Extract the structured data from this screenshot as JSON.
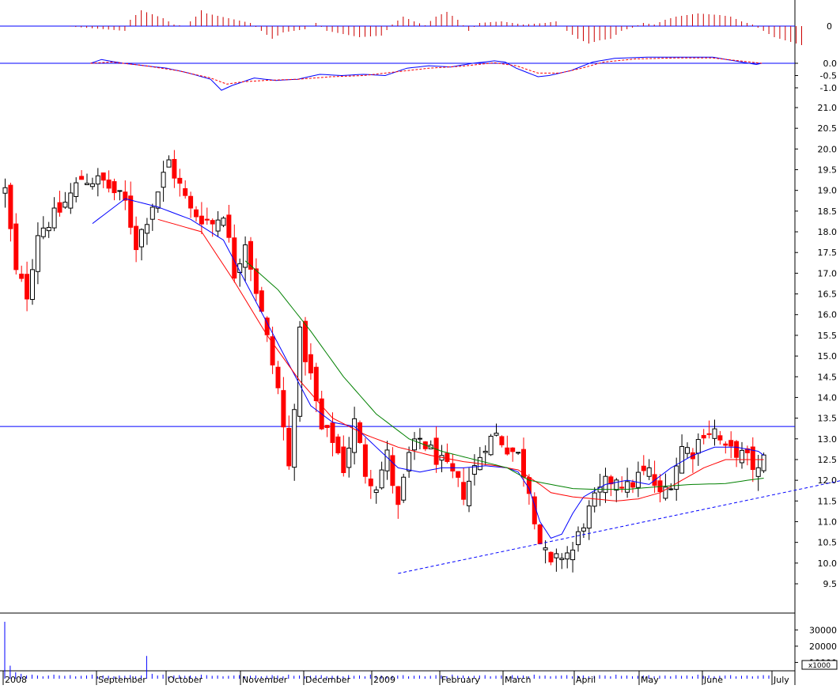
{
  "chart_data": {
    "type": "candlestick",
    "colors": {
      "up_candle": "#000000",
      "down_candle": "#ff0000",
      "ma_short": "#0000ff",
      "ma_medium": "#ff0000",
      "ma_long": "#008000",
      "hist": "#cc0000",
      "macd": "#0000ff",
      "macd_signal": "#ff0000",
      "resistance": "#0000ff",
      "trendline": "#0000ff",
      "volume": "#0000ff",
      "grid": "#000000"
    },
    "x_axis": {
      "labels": [
        "2008",
        "September",
        "October",
        "November",
        "December",
        "2009",
        "February",
        "March",
        "April",
        "May",
        "June",
        "July"
      ]
    },
    "price": {
      "ylim": [
        9.3,
        21.2
      ],
      "ticks": [
        "9.5",
        "10.0",
        "10.5",
        "11.0",
        "11.5",
        "12.0",
        "12.5",
        "13.0",
        "13.5",
        "14.0",
        "14.5",
        "15.0",
        "15.5",
        "16.0",
        "16.5",
        "17.0",
        "17.5",
        "18.0",
        "18.5",
        "19.0",
        "19.5",
        "20.0",
        "20.5",
        "21.0"
      ],
      "resistance": 13.3,
      "trendline": {
        "from": [
          72,
          9.75
        ],
        "to": [
          186,
          12.9
        ]
      },
      "close_anchors": [
        [
          0,
          19.0
        ],
        [
          2,
          17.0
        ],
        [
          4,
          16.5
        ],
        [
          6,
          18.0
        ],
        [
          10,
          18.5
        ],
        [
          14,
          19.3
        ],
        [
          18,
          19.2
        ],
        [
          22,
          18.7
        ],
        [
          24,
          17.7
        ],
        [
          28,
          19.0
        ],
        [
          30,
          19.7
        ],
        [
          34,
          18.5
        ],
        [
          38,
          18.2
        ],
        [
          40,
          18.5
        ],
        [
          42,
          17.0
        ],
        [
          44,
          17.8
        ],
        [
          47,
          16.0
        ],
        [
          50,
          14.2
        ],
        [
          52,
          12.3
        ],
        [
          54,
          15.5
        ],
        [
          56,
          14.5
        ],
        [
          58,
          13.2
        ],
        [
          60,
          13.0
        ],
        [
          62,
          12.3
        ],
        [
          64,
          13.4
        ],
        [
          66,
          12.2
        ],
        [
          68,
          11.9
        ],
        [
          70,
          12.6
        ],
        [
          72,
          11.3
        ],
        [
          74,
          12.6
        ],
        [
          76,
          13.0
        ],
        [
          78,
          12.7
        ],
        [
          80,
          12.4
        ],
        [
          82,
          12.1
        ],
        [
          84,
          11.7
        ],
        [
          86,
          12.3
        ],
        [
          88,
          12.9
        ],
        [
          90,
          13.1
        ],
        [
          92,
          12.8
        ],
        [
          94,
          12.6
        ],
        [
          96,
          11.8
        ],
        [
          98,
          10.5
        ],
        [
          100,
          9.9
        ],
        [
          102,
          10.2
        ],
        [
          104,
          10.3
        ],
        [
          106,
          11.0
        ],
        [
          108,
          11.5
        ],
        [
          110,
          11.9
        ],
        [
          112,
          12.1
        ],
        [
          114,
          11.8
        ],
        [
          116,
          12.1
        ],
        [
          118,
          12.2
        ],
        [
          120,
          11.6
        ],
        [
          122,
          12.0
        ],
        [
          124,
          12.8
        ],
        [
          126,
          12.7
        ],
        [
          128,
          13.2
        ],
        [
          130,
          13.2
        ],
        [
          132,
          12.7
        ],
        [
          134,
          12.7
        ],
        [
          136,
          12.5
        ],
        [
          138,
          12.2
        ],
        [
          139,
          12.5
        ]
      ],
      "ma_short_anchors": [
        [
          16,
          18.2
        ],
        [
          22,
          18.8
        ],
        [
          28,
          18.6
        ],
        [
          34,
          18.3
        ],
        [
          40,
          17.8
        ],
        [
          44,
          16.8
        ],
        [
          48,
          15.8
        ],
        [
          52,
          14.8
        ],
        [
          56,
          13.8
        ],
        [
          60,
          13.4
        ],
        [
          64,
          13.3
        ],
        [
          68,
          12.8
        ],
        [
          72,
          12.3
        ],
        [
          76,
          12.2
        ],
        [
          80,
          12.3
        ],
        [
          84,
          12.3
        ],
        [
          88,
          12.35
        ],
        [
          92,
          12.3
        ],
        [
          94,
          12.2
        ],
        [
          96,
          11.8
        ],
        [
          98,
          11.0
        ],
        [
          100,
          10.6
        ],
        [
          102,
          10.7
        ],
        [
          104,
          11.2
        ],
        [
          106,
          11.6
        ],
        [
          110,
          11.9
        ],
        [
          114,
          12.0
        ],
        [
          118,
          11.9
        ],
        [
          122,
          12.3
        ],
        [
          126,
          12.6
        ],
        [
          130,
          12.8
        ],
        [
          134,
          12.8
        ],
        [
          138,
          12.7
        ],
        [
          139,
          12.6
        ]
      ],
      "ma_medium_anchors": [
        [
          28,
          18.3
        ],
        [
          36,
          18.0
        ],
        [
          42,
          16.8
        ],
        [
          48,
          15.5
        ],
        [
          54,
          14.4
        ],
        [
          60,
          13.5
        ],
        [
          66,
          13.1
        ],
        [
          72,
          12.8
        ],
        [
          78,
          12.6
        ],
        [
          84,
          12.45
        ],
        [
          90,
          12.35
        ],
        [
          94,
          12.25
        ],
        [
          98,
          11.9
        ],
        [
          100,
          11.7
        ],
        [
          104,
          11.6
        ],
        [
          108,
          11.55
        ],
        [
          112,
          11.5
        ],
        [
          116,
          11.55
        ],
        [
          120,
          11.7
        ],
        [
          124,
          12.0
        ],
        [
          128,
          12.3
        ],
        [
          132,
          12.5
        ],
        [
          136,
          12.5
        ],
        [
          139,
          12.5
        ]
      ],
      "ma_long_anchors": [
        [
          44,
          17.3
        ],
        [
          50,
          16.6
        ],
        [
          56,
          15.6
        ],
        [
          62,
          14.5
        ],
        [
          68,
          13.6
        ],
        [
          74,
          13.0
        ],
        [
          80,
          12.7
        ],
        [
          86,
          12.5
        ],
        [
          92,
          12.3
        ],
        [
          96,
          12.0
        ],
        [
          100,
          11.9
        ],
        [
          104,
          11.8
        ],
        [
          108,
          11.78
        ],
        [
          114,
          11.78
        ],
        [
          120,
          11.85
        ],
        [
          126,
          11.9
        ],
        [
          132,
          11.92
        ],
        [
          136,
          12.0
        ],
        [
          139,
          12.05
        ]
      ]
    },
    "macd": {
      "ticks": [
        "0.0",
        "-0.5",
        "-1.0"
      ],
      "line_anchors": [
        [
          16,
          0.0
        ],
        [
          18,
          0.15
        ],
        [
          22,
          0.0
        ],
        [
          26,
          -0.1
        ],
        [
          30,
          -0.2
        ],
        [
          34,
          -0.4
        ],
        [
          38,
          -0.65
        ],
        [
          40,
          -1.1
        ],
        [
          42,
          -0.9
        ],
        [
          46,
          -0.6
        ],
        [
          50,
          -0.7
        ],
        [
          54,
          -0.65
        ],
        [
          58,
          -0.45
        ],
        [
          62,
          -0.5
        ],
        [
          66,
          -0.45
        ],
        [
          70,
          -0.5
        ],
        [
          74,
          -0.2
        ],
        [
          78,
          -0.1
        ],
        [
          82,
          -0.15
        ],
        [
          86,
          0.0
        ],
        [
          90,
          0.1
        ],
        [
          92,
          0.05
        ],
        [
          94,
          -0.2
        ],
        [
          98,
          -0.55
        ],
        [
          100,
          -0.5
        ],
        [
          104,
          -0.3
        ],
        [
          108,
          0.05
        ],
        [
          112,
          0.2
        ],
        [
          118,
          0.25
        ],
        [
          124,
          0.25
        ],
        [
          130,
          0.25
        ],
        [
          134,
          0.1
        ],
        [
          138,
          -0.05
        ],
        [
          139,
          0.0
        ]
      ],
      "signal_anchors": [
        [
          16,
          0.0
        ],
        [
          20,
          0.05
        ],
        [
          26,
          -0.1
        ],
        [
          32,
          -0.3
        ],
        [
          38,
          -0.6
        ],
        [
          41,
          -0.85
        ],
        [
          44,
          -0.75
        ],
        [
          48,
          -0.7
        ],
        [
          54,
          -0.65
        ],
        [
          60,
          -0.55
        ],
        [
          66,
          -0.5
        ],
        [
          72,
          -0.35
        ],
        [
          78,
          -0.2
        ],
        [
          84,
          -0.12
        ],
        [
          90,
          0.02
        ],
        [
          94,
          -0.1
        ],
        [
          98,
          -0.4
        ],
        [
          102,
          -0.4
        ],
        [
          106,
          -0.2
        ],
        [
          110,
          0.05
        ],
        [
          116,
          0.18
        ],
        [
          124,
          0.22
        ],
        [
          130,
          0.22
        ],
        [
          134,
          0.12
        ],
        [
          139,
          0.0
        ]
      ],
      "hist_anchors": [
        [
          0,
          0
        ],
        [
          11,
          -0.3
        ],
        [
          12,
          0.4
        ],
        [
          14,
          1.0
        ],
        [
          18,
          0.5
        ],
        [
          20,
          0.1
        ],
        [
          22,
          0.0
        ],
        [
          24,
          0.6
        ],
        [
          25,
          1.0
        ],
        [
          26,
          0.8
        ],
        [
          30,
          0.5
        ],
        [
          34,
          0.2
        ],
        [
          36,
          -0.3
        ],
        [
          38,
          -0.8
        ],
        [
          40,
          -0.4
        ],
        [
          44,
          -0.2
        ],
        [
          46,
          0.2
        ],
        [
          48,
          -0.3
        ],
        [
          54,
          -0.7
        ],
        [
          58,
          -0.6
        ],
        [
          60,
          0.1
        ],
        [
          62,
          0.6
        ],
        [
          64,
          0.3
        ],
        [
          66,
          0.05
        ],
        [
          68,
          0.6
        ],
        [
          70,
          0.9
        ],
        [
          72,
          0.4
        ],
        [
          74,
          -0.3
        ],
        [
          76,
          0.2
        ],
        [
          80,
          0.3
        ],
        [
          84,
          0.1
        ],
        [
          88,
          0.2
        ],
        [
          90,
          0.3
        ],
        [
          92,
          -0.3
        ],
        [
          94,
          -0.8
        ],
        [
          96,
          -1.1
        ],
        [
          98,
          -0.9
        ],
        [
          100,
          -0.8
        ],
        [
          102,
          -0.3
        ],
        [
          104,
          -0.1
        ],
        [
          106,
          0.2
        ],
        [
          108,
          0.1
        ],
        [
          110,
          0.4
        ],
        [
          112,
          0.6
        ],
        [
          114,
          0.7
        ],
        [
          116,
          0.8
        ],
        [
          118,
          0.75
        ],
        [
          120,
          0.7
        ],
        [
          122,
          0.6
        ],
        [
          124,
          0.3
        ],
        [
          126,
          0.1
        ],
        [
          128,
          -0.3
        ],
        [
          130,
          -0.7
        ],
        [
          132,
          -0.9
        ],
        [
          134,
          -1.1
        ],
        [
          135,
          -1.2
        ]
      ]
    },
    "volume": {
      "ticks": [
        "30000",
        "20000",
        "10000"
      ],
      "units_label": "x1000",
      "values": [
        35000,
        8000,
        4000,
        3000,
        2000,
        2500,
        2000,
        1500,
        2000,
        2500,
        2000,
        1800,
        2200,
        1500,
        1800,
        2000,
        2500,
        1500,
        2000,
        1800,
        1500,
        2000,
        1800,
        2200,
        1500,
        2000,
        14000,
        3000,
        2000,
        2500,
        1500,
        2000,
        2200,
        1800,
        2000,
        1500,
        2500,
        2200,
        1800,
        2000,
        1500,
        1800,
        2000,
        2200,
        1500,
        1800,
        2000,
        1500,
        1800,
        2200,
        2000,
        1500,
        2500,
        1800,
        2000,
        1500,
        1800,
        2000,
        2200,
        1500,
        1800,
        2000,
        1500,
        2200,
        1800,
        2000,
        1500,
        2500,
        1800,
        2000,
        1500,
        1800,
        2000,
        2200,
        1500,
        1800,
        2000,
        1500,
        1800,
        2200,
        2000,
        1500,
        2500,
        1800,
        2000,
        1500,
        1800,
        2000,
        2200,
        1500,
        1800,
        2000,
        1500,
        2200,
        1800,
        2000,
        1500,
        2500,
        1800,
        2000,
        1500,
        1800,
        2000,
        2200,
        1500,
        1800,
        2000,
        1500,
        1800,
        2200,
        2000,
        1500,
        2500,
        1800,
        2000,
        1500,
        1800,
        2000,
        2200,
        1500,
        1800,
        2000,
        1500,
        2200,
        1800,
        2000,
        1500,
        2500,
        1800,
        2000,
        1500,
        1800,
        2000,
        2200,
        1500,
        1800,
        2000,
        1500,
        1800,
        2200,
        2000
      ]
    }
  }
}
